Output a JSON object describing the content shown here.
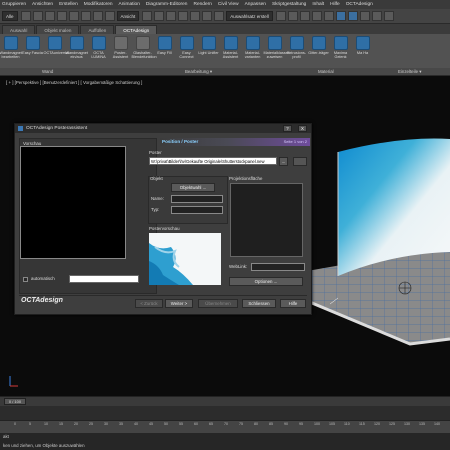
{
  "menubar": [
    "Gruppieren",
    "Ansichten",
    "Erstellen",
    "Modifikatoren",
    "Animation",
    "Diagramm-Editoren",
    "Rendern",
    "Civil View",
    "Anpassen",
    "Skriptgestaltung",
    "Inhalt",
    "Hilfe",
    "OCTAdesign"
  ],
  "toolbar": {
    "filter_select": "Alle",
    "view_select": "Ansicht",
    "selection_set": "Auswahlsatz erstell"
  },
  "tabs": [
    "Auswahl",
    "Objekt malen",
    "Auffüllen",
    "OCTAdesign"
  ],
  "active_tab_index": 3,
  "ribbon": [
    {
      "label": "Wandmagnet bearbeiten",
      "icon": "wall-magnet-icon"
    },
    {
      "label": "Easy Fascia",
      "icon": "easy-fascia-icon"
    },
    {
      "label": "OCTAuniversal",
      "icon": "octa-universal-icon"
    },
    {
      "label": "Wandmagnet ein/aus",
      "icon": "magnet-toggle-icon"
    },
    {
      "label": "OCTA LUMINA",
      "icon": "lumina-icon"
    },
    {
      "label": "Poster-Assistent",
      "icon": "poster-icon"
    },
    {
      "label": "Glashalter-Blendefunktion",
      "icon": "glass-holder-icon"
    },
    {
      "label": "Easy Fill",
      "icon": "easy-fill-icon"
    },
    {
      "label": "Easy Connect",
      "icon": "easy-connect-icon"
    },
    {
      "label": "Light Unifier",
      "icon": "light-unifier-icon"
    },
    {
      "label": "Material-Assistent",
      "icon": "material-assistant-icon"
    },
    {
      "label": "Material-varianten",
      "icon": "material-variants-icon"
    },
    {
      "label": "Materialklassen zuweisen",
      "icon": "material-classes-icon"
    },
    {
      "label": "Extrusions-profil",
      "icon": "extrusion-profile-icon"
    },
    {
      "label": "Gitter-träger",
      "icon": "truss-icon"
    },
    {
      "label": "Maxima Gelenk",
      "icon": "maxima-joint-icon"
    },
    {
      "label": "Ma Ha",
      "icon": "maxima-holder-icon"
    }
  ],
  "ribbon_groups": [
    "Wand",
    "Bearbeitung ▾",
    "Material",
    "Einzelteile ▾"
  ],
  "viewport_label": "[ + ] [Perspektive ] [Benutzerdefiniert ] [ Vorgabemäßige Schattierung ]",
  "dialog": {
    "title": "OCTAdesign Posterassistent",
    "help_btn": "?",
    "close_btn": "X",
    "vorschau_label": "Vorschau",
    "automatisch_label": "automatisch",
    "brand": "OCTAdesign",
    "header_title": "Position / Poster",
    "page_indicator": "Seite 1 von 2",
    "poster_label": "Poster",
    "poster_path": "W:\\privat\\Bilder\\hv\\Gekaufte Originale\\Shutterstockpanel.new",
    "browse_btn": "...",
    "objekt_label": "Objekt",
    "objektwahl_btn": "Objektwahl ...",
    "name_label": "Name:",
    "typ_label": "Typ:",
    "projektionsflaeche_label": "Projektionsfläche",
    "postervorschau_label": "Postervorschau",
    "weblink_label": "WebLink:",
    "optionen_btn": "Optionen ...",
    "zurueck_btn": "< Zurück",
    "weiter_btn": "Weiter >",
    "uebernehmen_btn": "Übernehmen",
    "schliessen_btn": "Schliessen",
    "hilfe_btn": "Hilfe"
  },
  "timeline": {
    "frame_counter": "0 / 100",
    "ticks": [
      "0",
      "5",
      "10",
      "15",
      "20",
      "25",
      "30",
      "35",
      "40",
      "45",
      "50",
      "55",
      "60",
      "65",
      "70",
      "75",
      "80",
      "85",
      "90",
      "95",
      "100",
      "105",
      "110",
      "115",
      "120",
      "125",
      "130",
      "135",
      "140"
    ]
  },
  "status": {
    "mode": "akt",
    "prompt": "ken und ziehen, um Objekte auszuwählen"
  }
}
